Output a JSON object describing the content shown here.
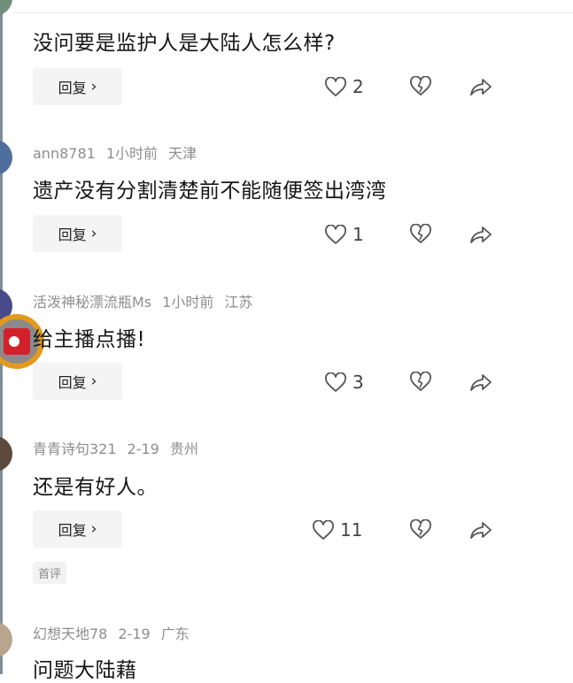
{
  "comments": [
    {
      "user": "",
      "time": "",
      "location": "",
      "text": "没问要是监护人是大陆人怎么样?",
      "reply_label": "回复",
      "likes": "2"
    },
    {
      "user": "ann8781",
      "time": "1小时前",
      "location": "天津",
      "text": "遗产没有分割清楚前不能随便签出湾湾",
      "reply_label": "回复",
      "likes": "1"
    },
    {
      "user": "活泼神秘漂流瓶Ms",
      "time": "1小时前",
      "location": "江苏",
      "text": "给主播点播!",
      "reply_label": "回复",
      "likes": "3"
    },
    {
      "user": "青青诗句321",
      "time": "2-19",
      "location": "贵州",
      "text": "还是有好人。",
      "reply_label": "回复",
      "likes": "11",
      "badge": "首评"
    },
    {
      "user": "幻想天地78",
      "time": "2-19",
      "location": "广东",
      "text": "问题大陆藉"
    }
  ],
  "icons": {
    "like": "heart-outline-icon",
    "dislike": "broken-heart-icon",
    "share": "share-arrow-icon",
    "chevron": "chevron-right-icon"
  },
  "colors": {
    "meta_text": "#8e8e8e",
    "reply_bg": "#f4f4f4",
    "avatar_badge": "#d3212b",
    "avatar_ring": "#e39a1b"
  }
}
